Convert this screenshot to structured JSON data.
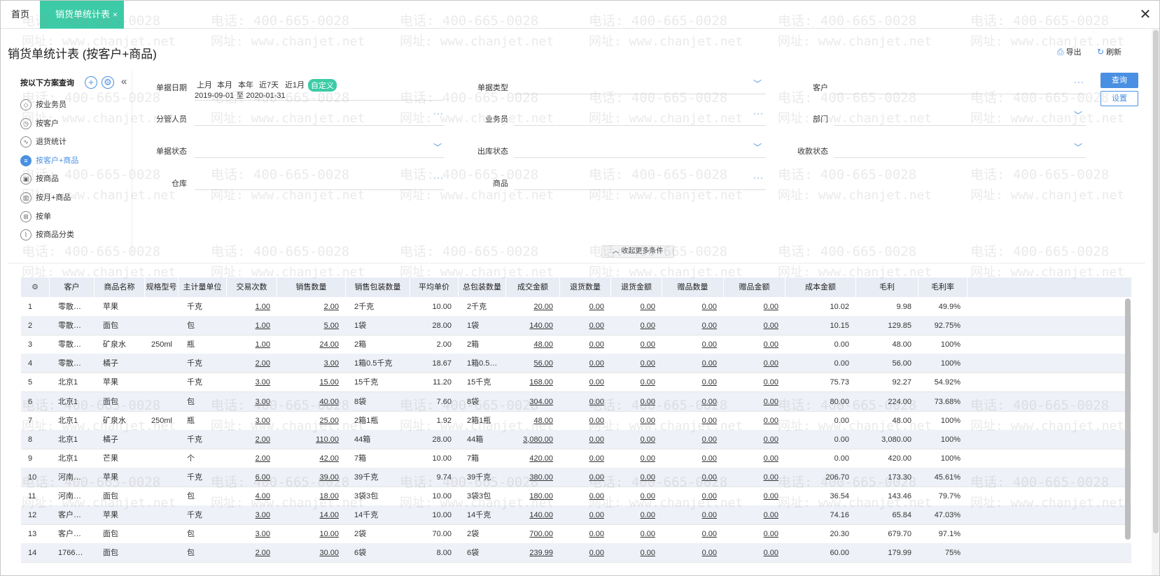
{
  "tabs": {
    "home": "首页",
    "active": "销货单统计表",
    "active_close": "×"
  },
  "window": {
    "close": "✕"
  },
  "page": {
    "title": "销货单统计表 (按客户+商品)",
    "export": "导出",
    "refresh": "刷新"
  },
  "sidebar": {
    "heading": "按以下方案查询",
    "items": [
      {
        "label": "按业务员",
        "icon": "cube-icon"
      },
      {
        "label": "按客户",
        "icon": "clock-icon"
      },
      {
        "label": "退货统计",
        "icon": "trend-icon"
      },
      {
        "label": "按客户+商品",
        "icon": "table-icon",
        "active": true
      },
      {
        "label": "按商品",
        "icon": "product-icon"
      },
      {
        "label": "按月+商品",
        "icon": "bar-chart-icon"
      },
      {
        "label": "按单",
        "icon": "grid-icon"
      },
      {
        "label": "按商品分类",
        "icon": "line-chart-icon"
      }
    ]
  },
  "filters": {
    "date_label": "单据日期",
    "date_quick": [
      "上月",
      "本月",
      "本年",
      "近7天",
      "近1月",
      "自定义"
    ],
    "date_range": "2019-09-01 至 2020-01-31",
    "doc_type": "单据类型",
    "customer": "客户",
    "manager": "分管人员",
    "salesman": "业务员",
    "department": "部门",
    "doc_status": "单据状态",
    "outbound_status": "出库状态",
    "payment_status": "收款状态",
    "warehouse": "仓库",
    "product": "商品",
    "query_btn": "查询",
    "settings_btn": "设置",
    "collapse": "收起更多条件"
  },
  "watermark": {
    "phone": "电话: 400-665-0028",
    "site": "网址: www.chanjet.net"
  },
  "table": {
    "headers": [
      "客户",
      "商品名称",
      "规格型号",
      "主计量单位",
      "交易次数",
      "销售数量",
      "销售包装数量",
      "平均单价",
      "总包装数量",
      "成交金额",
      "退货数量",
      "退货金额",
      "赠品数量",
      "赠品金额",
      "成本金额",
      "毛利",
      "毛利率"
    ],
    "rows": [
      [
        "1",
        "零散…",
        "苹果",
        "",
        "千克",
        "1.00",
        "2.00",
        "2千克",
        "10.00",
        "2千克",
        "20.00",
        "0.00",
        "0.00",
        "0.00",
        "0.00",
        "10.02",
        "9.98",
        "49.9%"
      ],
      [
        "2",
        "零散…",
        "面包",
        "",
        "包",
        "1.00",
        "5.00",
        "1袋",
        "28.00",
        "1袋",
        "140.00",
        "0.00",
        "0.00",
        "0.00",
        "0.00",
        "10.15",
        "129.85",
        "92.75%"
      ],
      [
        "3",
        "零散…",
        "矿泉水",
        "250ml",
        "瓶",
        "1.00",
        "24.00",
        "2箱",
        "2.00",
        "2箱",
        "48.00",
        "0.00",
        "0.00",
        "0.00",
        "0.00",
        "0.00",
        "48.00",
        "100%"
      ],
      [
        "4",
        "零散…",
        "橘子",
        "",
        "千克",
        "2.00",
        "3.00",
        "1箱0.5千克",
        "18.67",
        "1箱0.5…",
        "56.00",
        "0.00",
        "0.00",
        "0.00",
        "0.00",
        "0.00",
        "56.00",
        "100%"
      ],
      [
        "5",
        "北京1",
        "苹果",
        "",
        "千克",
        "3.00",
        "15.00",
        "15千克",
        "11.20",
        "15千克",
        "168.00",
        "0.00",
        "0.00",
        "0.00",
        "0.00",
        "75.73",
        "92.27",
        "54.92%"
      ],
      [
        "6",
        "北京1",
        "面包",
        "",
        "包",
        "3.00",
        "40.00",
        "8袋",
        "7.60",
        "8袋",
        "304.00",
        "0.00",
        "0.00",
        "0.00",
        "0.00",
        "80.00",
        "224.00",
        "73.68%"
      ],
      [
        "7",
        "北京1",
        "矿泉水",
        "250ml",
        "瓶",
        "3.00",
        "25.00",
        "2箱1瓶",
        "1.92",
        "2箱1瓶",
        "48.00",
        "0.00",
        "0.00",
        "0.00",
        "0.00",
        "0.00",
        "48.00",
        "100%"
      ],
      [
        "8",
        "北京1",
        "橘子",
        "",
        "千克",
        "2.00",
        "110.00",
        "44箱",
        "28.00",
        "44箱",
        "3,080.00",
        "0.00",
        "0.00",
        "0.00",
        "0.00",
        "0.00",
        "3,080.00",
        "100%"
      ],
      [
        "9",
        "北京1",
        "芒果",
        "",
        "个",
        "2.00",
        "42.00",
        "7箱",
        "10.00",
        "7箱",
        "420.00",
        "0.00",
        "0.00",
        "0.00",
        "0.00",
        "0.00",
        "420.00",
        "100%"
      ],
      [
        "10",
        "河南…",
        "苹果",
        "",
        "千克",
        "6.00",
        "39.00",
        "39千克",
        "9.74",
        "39千克",
        "380.00",
        "0.00",
        "0.00",
        "0.00",
        "0.00",
        "206.70",
        "173.30",
        "45.61%"
      ],
      [
        "11",
        "河南…",
        "面包",
        "",
        "包",
        "4.00",
        "18.00",
        "3袋3包",
        "10.00",
        "3袋3包",
        "180.00",
        "0.00",
        "0.00",
        "0.00",
        "0.00",
        "36.54",
        "143.46",
        "79.7%"
      ],
      [
        "12",
        "客户…",
        "苹果",
        "",
        "千克",
        "3.00",
        "14.00",
        "14千克",
        "10.00",
        "14千克",
        "140.00",
        "0.00",
        "0.00",
        "0.00",
        "0.00",
        "74.16",
        "65.84",
        "47.03%"
      ],
      [
        "13",
        "客户…",
        "面包",
        "",
        "包",
        "3.00",
        "10.00",
        "2袋",
        "70.00",
        "2袋",
        "700.00",
        "0.00",
        "0.00",
        "0.00",
        "0.00",
        "20.30",
        "679.70",
        "97.1%"
      ],
      [
        "14",
        "1766…",
        "面包",
        "",
        "包",
        "2.00",
        "30.00",
        "6袋",
        "8.00",
        "6袋",
        "239.99",
        "0.00",
        "0.00",
        "0.00",
        "0.00",
        "60.00",
        "179.99",
        "75%"
      ]
    ]
  },
  "colors": {
    "accent": "#3ccba6",
    "primary": "#4a90e2",
    "header_bg": "#e8ecf4",
    "row_alt": "#eef1f7"
  }
}
